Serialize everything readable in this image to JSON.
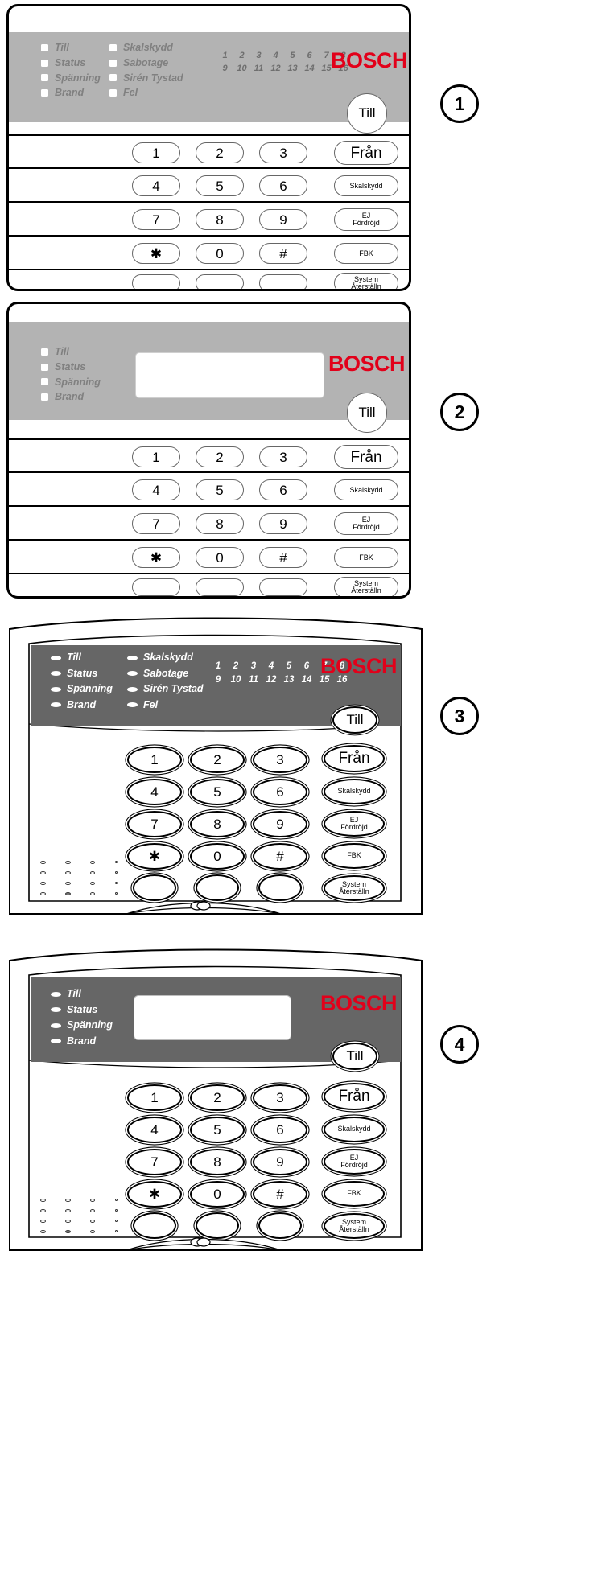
{
  "meta": {
    "device_brand": "BOSCH",
    "bosch_color": "#e2001a",
    "header_gray_flat": "#b3b3b3",
    "header_gray_3d": "#666666"
  },
  "status_leds": {
    "left": [
      "Till",
      "Status",
      "Spänning",
      "Brand"
    ],
    "right": [
      "Skalskydd",
      "Sabotage",
      "Sirén Tystad",
      "Fel"
    ]
  },
  "zones": {
    "row1": [
      "1",
      "2",
      "3",
      "4",
      "5",
      "6",
      "7",
      "8"
    ],
    "row2": [
      "9",
      "10",
      "11",
      "12",
      "13",
      "14",
      "15",
      "16"
    ]
  },
  "keypad": {
    "rows": [
      [
        "1",
        "2",
        "3"
      ],
      [
        "4",
        "5",
        "6"
      ],
      [
        "7",
        "8",
        "9"
      ],
      [
        "✱",
        "0",
        "#"
      ],
      [
        "",
        "",
        ""
      ]
    ]
  },
  "function_keys": {
    "till": "Till",
    "fran": "Från",
    "skalskydd": "Skalskydd",
    "ej_fordrojd_line1": "EJ",
    "ej_fordrojd_line2": "Fördröjd",
    "fbk": "FBK",
    "system_line1": "System",
    "system_line2": "Återställn"
  },
  "markers": {
    "one": "1",
    "two": "2",
    "three": "3",
    "four": "4"
  },
  "panels": [
    {
      "id": "panel-1",
      "marker": "1",
      "style": "flat",
      "has_lcd": false,
      "has_zone_leds": true,
      "led_columns": 2
    },
    {
      "id": "panel-2",
      "marker": "2",
      "style": "flat",
      "has_lcd": true,
      "has_zone_leds": false,
      "led_columns": 1
    },
    {
      "id": "panel-3",
      "marker": "3",
      "style": "3d",
      "has_lcd": false,
      "has_zone_leds": true,
      "led_columns": 2
    },
    {
      "id": "panel-4",
      "marker": "4",
      "style": "3d",
      "has_lcd": true,
      "has_zone_leds": false,
      "led_columns": 1
    }
  ]
}
